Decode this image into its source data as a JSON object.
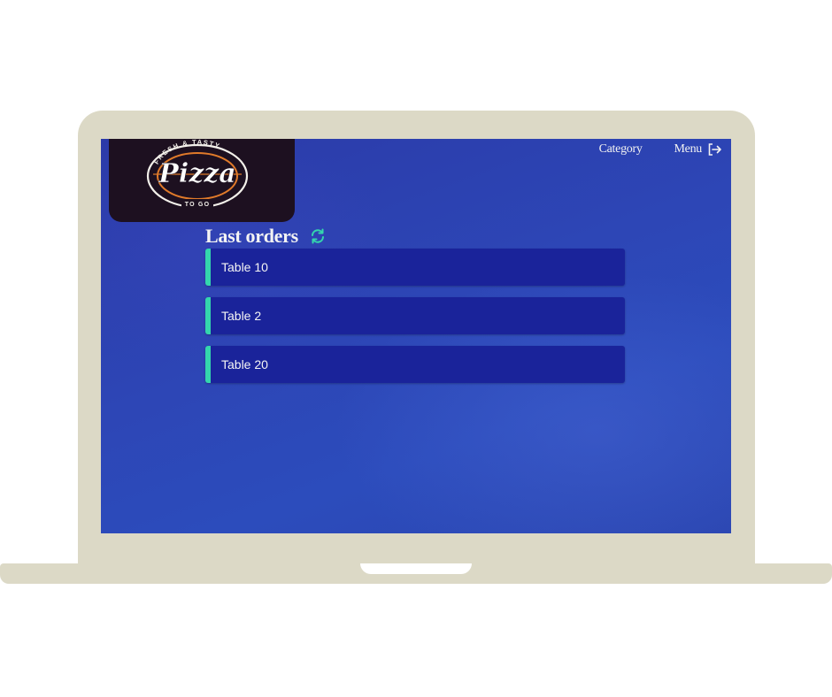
{
  "brand": {
    "logo_top_text": "FRESH & TASTY",
    "logo_main_text": "Pizza",
    "logo_bottom_text": "TO GO"
  },
  "nav": {
    "category_label": "Category",
    "menu_label": "Menu",
    "menu_icon": "logout-icon"
  },
  "orders": {
    "title": "Last orders",
    "refresh_icon": "refresh-icon",
    "accent_color": "#34d6ad",
    "items": [
      {
        "label": "Table 10"
      },
      {
        "label": "Table 2"
      },
      {
        "label": "Table 20"
      }
    ]
  },
  "colors": {
    "screen_background": "#2c44b4",
    "card_background": "#1a239a",
    "laptop_frame": "#dcd9c6"
  }
}
